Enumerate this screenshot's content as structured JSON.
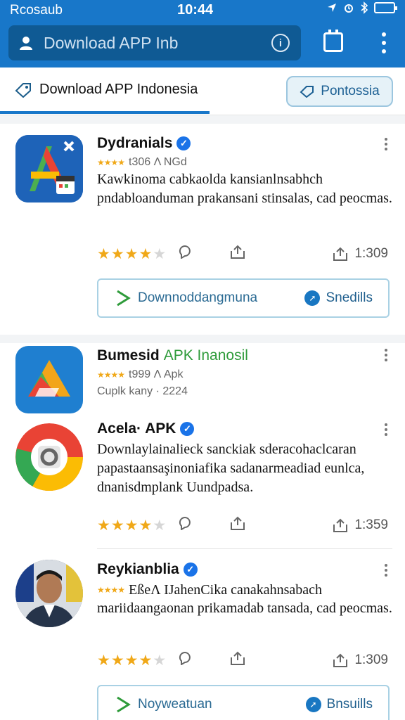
{
  "status_bar": {
    "carrier": "Rcosaub",
    "time": "10:44"
  },
  "search": {
    "placeholder": "Download APP Inb"
  },
  "tabs": {
    "active": "Download APP Indonesia",
    "pill": "Pontossia"
  },
  "colors": {
    "primary": "#1877c9",
    "star": "#f0a818",
    "verified": "#1a73e8",
    "green_tag": "#2e9b3a"
  },
  "apps": [
    {
      "name": "Dydranials",
      "meta": "t306 Λ NGd",
      "description": "Kawkinoma cabkaolda kansianlnsabhch pndabloanduman prakansani stinsalas, cad peocmas.",
      "rating": 3.5,
      "count": "1:309",
      "download_label": "Downnoddangmuna",
      "share_label": "Snedills"
    },
    {
      "name": "Bumesid",
      "tag": "APK Inanosil",
      "meta": "t999 Λ Apk",
      "sub": "Cuplk kany · 2224"
    },
    {
      "name": "Acela· APK",
      "description": "Downlaylainalieck sanckiak sderacohaclcaran papastaansaşinoniafika sadanarmeadiad eunlca, dnanisdmplank Uundpadsa.",
      "rating": 3.5,
      "count": "1:359"
    },
    {
      "name": "Reykianblia",
      "meta": "EßeΛ IJahenCika canakahnsabach",
      "description": "mariidaangaonan prikamadab tansada, cad peocmas.",
      "rating": 3.5,
      "count": "1:309",
      "download_label": "Noyweatuan",
      "share_label": "Bnsuills"
    }
  ]
}
